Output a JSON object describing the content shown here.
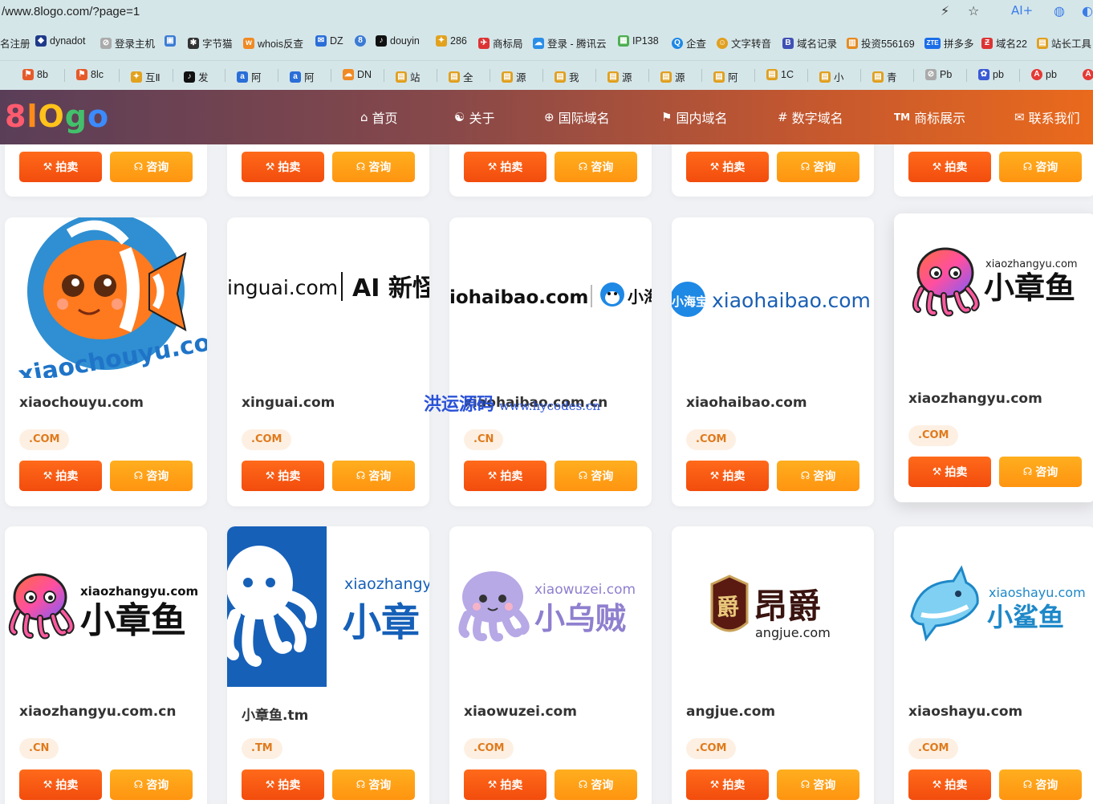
{
  "browser": {
    "url": "/www.8logo.com/?page=1",
    "bookmarks_row1": [
      {
        "label": "名注册",
        "color": "#ffffff"
      },
      {
        "label": "dynadot",
        "color": "#1f3a8a"
      },
      {
        "label": "登录主机",
        "color": "#666666"
      },
      {
        "label": "",
        "color": "#3a7bd5"
      },
      {
        "label": "字节猫",
        "color": "#333333"
      },
      {
        "label": "whois反查",
        "color": "#f08a24"
      },
      {
        "label": "DZ",
        "color": "#2a6ed8"
      },
      {
        "label": "",
        "color": "#3a7bd5"
      },
      {
        "label": "douyin",
        "color": "#111111"
      },
      {
        "label": "286",
        "color": "#e2a21d"
      },
      {
        "label": "商标局",
        "color": "#d33"
      },
      {
        "label": "登录 - 腾讯云",
        "color": "#2a8ee8"
      },
      {
        "label": "IP138",
        "color": "#4caf50"
      },
      {
        "label": "企查",
        "color": "#1e88e5"
      },
      {
        "label": "文字转音",
        "color": "#e0a020"
      },
      {
        "label": "域名记录",
        "color": "#3f51b5"
      },
      {
        "label": "投资556169",
        "color": "#e68a1f"
      },
      {
        "label": "拼多多",
        "color": "#1c6ee8"
      },
      {
        "label": "域名22",
        "color": "#d33"
      },
      {
        "label": "站长工具",
        "color": "#e0a020"
      }
    ],
    "bookmarks_row2": [
      {
        "label": "8b"
      },
      {
        "label": "8lc"
      },
      {
        "label": "互Ⅱ"
      },
      {
        "label": "发"
      },
      {
        "label": "阿"
      },
      {
        "label": "阿"
      },
      {
        "label": "DN"
      },
      {
        "label": "站"
      },
      {
        "label": "全"
      },
      {
        "label": "源"
      },
      {
        "label": "我"
      },
      {
        "label": "源"
      },
      {
        "label": "源"
      },
      {
        "label": "阿"
      },
      {
        "label": "1C"
      },
      {
        "label": "小"
      },
      {
        "label": "青"
      },
      {
        "label": "Pb"
      },
      {
        "label": "pb"
      },
      {
        "label": "pb"
      }
    ]
  },
  "site": {
    "logo": [
      "8",
      "l",
      "O",
      "g",
      "o"
    ],
    "logo_colors": [
      "#ff5b6e",
      "#ff8c1a",
      "#ffc21a",
      "#43c06b",
      "#3b8bff"
    ],
    "nav": [
      {
        "icon": "⌂",
        "label": "首页"
      },
      {
        "icon": "👤",
        "label": "关于"
      },
      {
        "icon": "⊕",
        "label": "国际域名"
      },
      {
        "icon": "⚑",
        "label": "国内域名"
      },
      {
        "icon": "#",
        "label": "数字域名"
      },
      {
        "icon": "TM",
        "label": "商标展示"
      },
      {
        "icon": "✉",
        "label": "联系我们"
      }
    ]
  },
  "buttons": {
    "auction": "拍卖",
    "consult": "咨询",
    "auction_icon": "hammer-icon",
    "consult_icon": "headset-icon"
  },
  "cards": [
    {
      "domain": "xiaochouyu.com",
      "tld": ".COM",
      "logo_text": "xiaochouyu.com"
    },
    {
      "domain": "xinguai.com",
      "tld": ".COM",
      "logo_text": "inguai.com",
      "logo_text2": "AI 新怪"
    },
    {
      "domain": "xiaohaibao.com.cn",
      "tld": ".CN",
      "logo_text": "iohaibao.com",
      "logo_text2": "小海"
    },
    {
      "domain": "xiaohaibao.com",
      "tld": ".COM",
      "logo_text": "xiaohaibao.com",
      "logo_text2": "小海宝"
    },
    {
      "domain": "xiaozhangyu.com",
      "tld": ".COM",
      "logo_text": "xiaozhangyu.com",
      "logo_text2": "小章鱼"
    },
    {
      "domain": "xiaozhangyu.com.cn",
      "tld": ".CN",
      "logo_text": "xiaozhangyu.com",
      "logo_text2": "小章鱼"
    },
    {
      "domain": "小章鱼.tm",
      "tld": ".TM",
      "logo_text": "xiaozhangy",
      "logo_text2": "小章"
    },
    {
      "domain": "xiaowuzei.com",
      "tld": ".COM",
      "logo_text": "xiaowuzei.com",
      "logo_text2": "小乌贼"
    },
    {
      "domain": "angjue.com",
      "tld": ".COM",
      "logo_text": "angjue.com",
      "logo_text2": "昂爵",
      "logo_text3": "爵"
    },
    {
      "domain": "xiaoshayu.com",
      "tld": ".COM",
      "logo_text": "xiaoshayu.com",
      "logo_text2": "小鲨鱼"
    }
  ],
  "watermark": {
    "text": "洪运源码",
    "url": "www.hycodes.cn"
  }
}
